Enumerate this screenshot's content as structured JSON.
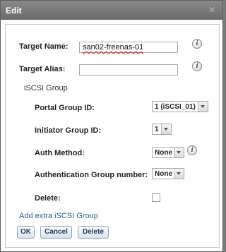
{
  "dialog": {
    "title": "Edit"
  },
  "form": {
    "target_name": {
      "label": "Target Name:",
      "value": "san02-freenas-01"
    },
    "target_alias": {
      "label": "Target Alias:",
      "value": ""
    },
    "iscsi_group": {
      "label": "iSCSI Group"
    },
    "portal_group": {
      "label": "Portal Group ID:",
      "selected": "1 (iSCSI_01)"
    },
    "initiator_group": {
      "label": "Initiator Group ID:",
      "selected": "1"
    },
    "auth_method": {
      "label": "Auth Method:",
      "selected": "None"
    },
    "auth_group": {
      "label": "Authentication Group number:",
      "selected": "None"
    },
    "delete": {
      "label": "Delete:",
      "checked": false
    },
    "add_group_link": "Add extra iSCSI Group"
  },
  "buttons": {
    "ok": "OK",
    "cancel": "Cancel",
    "delete": "Delete"
  },
  "icons": {
    "close": "close-icon",
    "info": "info-icon"
  }
}
